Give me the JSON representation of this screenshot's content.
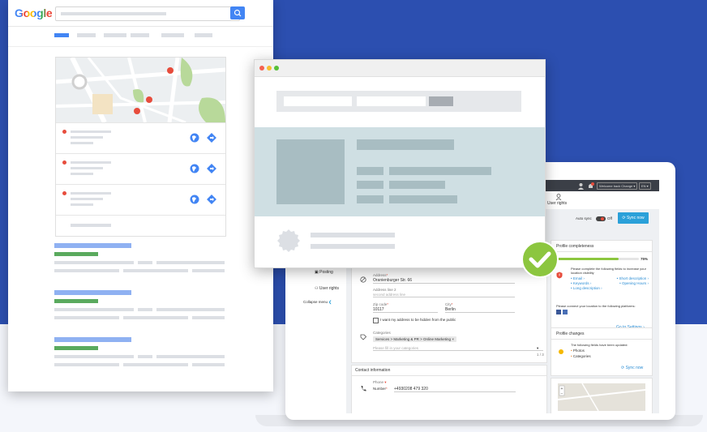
{
  "google": {
    "logo": "Google"
  },
  "sidebar": {
    "items": [
      {
        "label": "Posting"
      },
      {
        "label": "User rights"
      }
    ],
    "collapse_label": "Collapse menu"
  },
  "topbar": {
    "welcome_label": "Welcome back Change",
    "lang_label": "EN",
    "user_rights_label": "User rights"
  },
  "sync": {
    "autosync_label": "Auto sync",
    "toggle_state": "Off",
    "sync_now_label": "Sync now"
  },
  "address_form": {
    "address_label": "Address",
    "address_value": "Oranienburger Str. 66",
    "address2_label": "Address line 2",
    "address2_placeholder": "second address line",
    "zip_label": "Zip code",
    "zip_value": "10117",
    "city_label": "City",
    "city_value": "Berlin",
    "hide_checkbox_label": "I want my address to be hidden from the public",
    "categories_label": "Categories",
    "category_tag": "Services > Marketing & PR > Online Marketing",
    "categories_placeholder": "Please fill in your categories",
    "categories_count": "1 / 3"
  },
  "contact": {
    "section_title": "Contact information",
    "phone_label": "Phone",
    "number_label": "Number",
    "number_value": "+4930208 479 320"
  },
  "profile_completeness": {
    "title": "Profile completeness",
    "percent": 75,
    "percent_label": "75%",
    "info_text": "Please complete the following fields to increase your location visibility",
    "missing_fields": [
      "Email",
      "Short description",
      "Keywords",
      "Opening Hours",
      "Long description"
    ],
    "connect_text": "Please connect your location to the following platforms:",
    "go_to_settings": "Go to Settings"
  },
  "profile_changes": {
    "title": "Profile changes",
    "info_text": "The following fields have been updated:",
    "fields": [
      "Photos",
      "Categories"
    ],
    "sync_now_label": "Sync now"
  },
  "colors": {
    "background_blue": "#2c4fb0",
    "accent_green": "#8cc63f",
    "link_blue": "#2a8dd4",
    "google_blue": "#4285f4",
    "sync_button": "#2aa0d9"
  }
}
